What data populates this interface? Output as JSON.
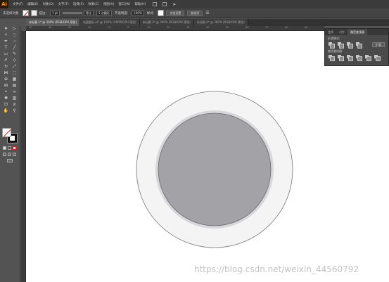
{
  "app": {
    "logo": "Ai"
  },
  "menu": [
    {
      "label": "文件(F)"
    },
    {
      "label": "编辑(E)"
    },
    {
      "label": "对象(O)"
    },
    {
      "label": "文字(T)"
    },
    {
      "label": "选择(S)"
    },
    {
      "label": "效果(C)"
    },
    {
      "label": "视图(V)"
    },
    {
      "label": "窗口(W)"
    },
    {
      "label": "帮助(H)"
    }
  ],
  "control": {
    "selection_label": "未选择对象",
    "stroke_label": "描边:",
    "stroke_weight": "1 pt",
    "stroke_profile": "等比",
    "brush": "5 点圆形",
    "opacity_label": "不透明度:",
    "opacity_value": "100%",
    "style_label": "样式:",
    "doc_setup": "文档设置",
    "preferences": "首选项"
  },
  "tabs": [
    {
      "label": "未标题-1* @ 300% (RGB/GPU 预览)",
      "active": true
    },
    {
      "label": "矢量图标.ai* @ 100% (CMYK/GPU 预览)",
      "active": false
    },
    {
      "label": "未标题-3* @ 300% (RGB/GPU 预览)",
      "active": false
    },
    {
      "label": "未标题-4* @ 300% (RGB/GPU 预览)",
      "active": false
    }
  ],
  "ruler": {
    "ticks": [
      "50",
      "40",
      "30",
      "20",
      "10",
      "0",
      "10",
      "20",
      "30",
      "40",
      "50",
      "60",
      "70",
      "80",
      "90"
    ]
  },
  "panel": {
    "tabs": [
      {
        "label": "变换",
        "active": false
      },
      {
        "label": "对齐",
        "active": false
      },
      {
        "label": "路径查找器",
        "active": true
      }
    ],
    "shape_modes_label": "形状模式:",
    "pathfinders_label": "路径查找器:",
    "apply_label": "扩展"
  },
  "watermark": "https://blog.csdn.net/weixin_44560792",
  "artwork": {
    "outer_fill": "#f4f4f4",
    "outer_stroke": "#777777",
    "ring_fill": "#d8d8dc",
    "inner_fill": "#a3a3a7",
    "inner_stroke": "#6a6a6a"
  }
}
